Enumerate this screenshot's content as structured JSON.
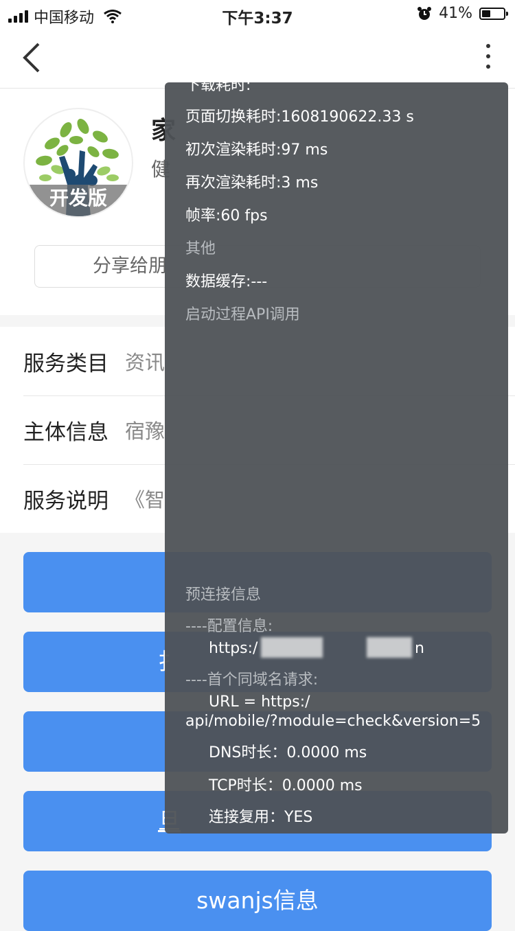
{
  "status_bar": {
    "carrier": "中国移动",
    "time": "下午3:37",
    "battery_percent": "41%",
    "battery_level": 0.41,
    "icons": [
      "signal-icon",
      "wifi-icon",
      "alarm-icon",
      "battery-icon"
    ]
  },
  "nav": {
    "back_icon": "chevron-left-icon",
    "more_icon": "more-vertical-icon"
  },
  "header": {
    "avatar_badge": "开发版",
    "title": "家",
    "subtitle": "健",
    "share_label": "分享给朋"
  },
  "info": {
    "rows": [
      {
        "label": "服务类目",
        "value": "资讯"
      },
      {
        "label": "主体信息",
        "value": "宿豫"
      },
      {
        "label": "服务说明",
        "value": "《智"
      }
    ]
  },
  "actions": {
    "buttons": [
      "",
      "扌",
      "",
      "旦",
      "swanjs信息"
    ]
  },
  "debug": {
    "cut_top": "下载耗时:",
    "page_switch": "页面切换耗时:1608190622.33 s",
    "first_render": "初次渲染耗时:97 ms",
    "re_render": "再次渲染耗时:3 ms",
    "fps": "帧率:60 fps",
    "other_header": "其他",
    "data_cache": "数据缓存:---",
    "startup_api_header": "启动过程API调用",
    "preconnect_header": "预连接信息",
    "config_header": "----配置信息:",
    "config_url_prefix": "https:/",
    "config_url_suffix": "n",
    "first_request_header": "----首个同域名请求:",
    "request_url_prefix": "URL = https:/",
    "request_url_line2": "api/mobile/?module=check&version=5",
    "dns": "DNS时长：0.0000 ms",
    "tcp": "TCP时长：0.0000 ms",
    "reuse_cut": "连接复用：YES"
  },
  "colors": {
    "primary_button": "#4a90f0",
    "debug_panel": "#4e5256"
  }
}
